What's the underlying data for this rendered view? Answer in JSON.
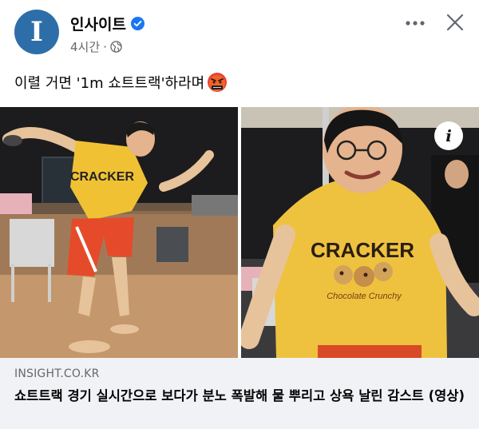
{
  "post": {
    "page_name": "인사이트",
    "avatar_letter": "I",
    "timestamp": "4시간",
    "meta_separator": "·",
    "text": "이렬 거면 '1m 쇼트트랙'하라며"
  },
  "icons": {
    "verified": "verified-badge-icon",
    "audience": "globe-icon",
    "more": "more-horizontal-icon",
    "close": "close-icon",
    "emoji": "angry-face-emoji-icon",
    "info": "info-icon"
  },
  "media": {
    "shirt_text": "CRACKER",
    "shirt_subtext": "Chocolate Crunchy"
  },
  "link": {
    "domain": "INSIGHT.CO.KR",
    "title": "쇼트트랙 경기 실시간으로 보다가 분노 폭발해 물 뿌리고 상욕 날린 감스트 (영상)"
  },
  "colors": {
    "brand": "#2d6ea9",
    "verified": "#1877f2",
    "secondary_text": "#65676b",
    "card_bg": "#f0f2f5"
  }
}
